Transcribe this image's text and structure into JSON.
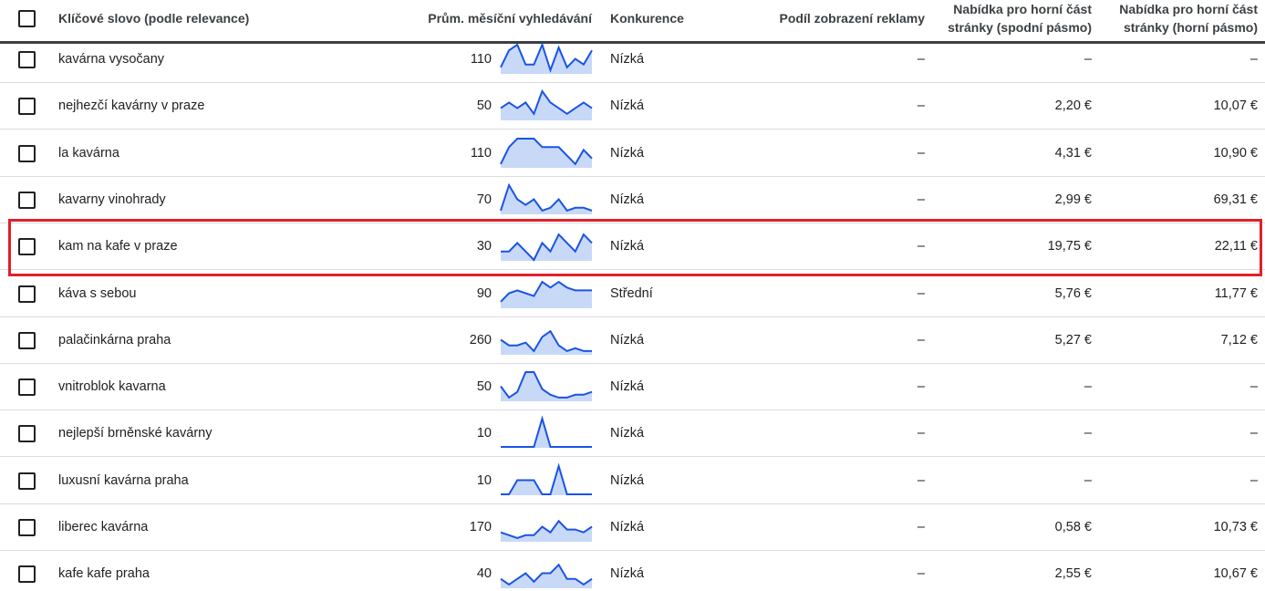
{
  "colors": {
    "spark_line": "#1a53e6",
    "spark_fill": "#c8d9f8",
    "highlight": "#e0202a"
  },
  "header": {
    "keyword": "Klíčové slovo (podle relevance)",
    "avg_searches": "Prům. měsíční vyhledávání",
    "competition": "Konkurence",
    "ad_impression_share": "Podíl zobrazení reklamy",
    "bid_low_line1": "Nabídka pro horní část",
    "bid_low_line2": "stránky (spodní pásmo)",
    "bid_high_line1": "Nabídka pro horní část",
    "bid_high_line2": "stránky (horní pásmo)"
  },
  "rows": [
    {
      "keyword": "kavárna vysočany",
      "searches": "110",
      "competition": "Nízká",
      "share": "–",
      "bid_low": "–",
      "bid_high": "–",
      "trend": [
        2,
        8,
        10,
        3,
        3,
        10,
        1,
        9,
        2,
        5,
        3,
        8
      ]
    },
    {
      "keyword": "nejhezčí kavárny v praze",
      "searches": "50",
      "competition": "Nízká",
      "share": "–",
      "bid_low": "2,20 €",
      "bid_high": "10,07 €",
      "trend": [
        4,
        6,
        4,
        6,
        2,
        10,
        6,
        4,
        2,
        4,
        6,
        4
      ]
    },
    {
      "keyword": "la kavárna",
      "searches": "110",
      "competition": "Nízká",
      "share": "–",
      "bid_low": "4,31 €",
      "bid_high": "10,90 €",
      "trend": [
        1,
        7,
        10,
        10,
        10,
        7,
        7,
        7,
        4,
        1,
        6,
        3
      ]
    },
    {
      "keyword": "kavarny vinohrady",
      "searches": "70",
      "competition": "Nízká",
      "share": "–",
      "bid_low": "2,99 €",
      "bid_high": "69,31 €",
      "trend": [
        1,
        10,
        5,
        3,
        5,
        1,
        2,
        5,
        1,
        2,
        2,
        1
      ]
    },
    {
      "keyword": "kam na kafe v praze",
      "searches": "30",
      "competition": "Nízká",
      "share": "–",
      "bid_low": "19,75 €",
      "bid_high": "22,11 €",
      "trend": [
        3,
        3,
        6,
        3,
        0,
        6,
        3,
        9,
        6,
        3,
        9,
        6
      ]
    },
    {
      "keyword": "káva s sebou",
      "searches": "90",
      "competition": "Střední",
      "share": "–",
      "bid_low": "5,76 €",
      "bid_high": "11,77 €",
      "trend": [
        2,
        5,
        6,
        5,
        4,
        9,
        7,
        9,
        7,
        6,
        6,
        6
      ]
    },
    {
      "keyword": "palačinkárna praha",
      "searches": "260",
      "competition": "Nízká",
      "share": "–",
      "bid_low": "5,27 €",
      "bid_high": "7,12 €",
      "trend": [
        5,
        3,
        3,
        4,
        1,
        6,
        8,
        3,
        1,
        2,
        1,
        1
      ]
    },
    {
      "keyword": "vnitroblok kavarna",
      "searches": "50",
      "competition": "Nízká",
      "share": "–",
      "bid_low": "–",
      "bid_high": "–",
      "trend": [
        5,
        1,
        3,
        10,
        10,
        4,
        2,
        1,
        1,
        2,
        2,
        3
      ]
    },
    {
      "keyword": "nejlepší brněnské kavárny",
      "searches": "10",
      "competition": "Nízká",
      "share": "–",
      "bid_low": "–",
      "bid_high": "–",
      "trend": [
        0,
        0,
        0,
        0,
        0,
        10,
        0,
        0,
        0,
        0,
        0,
        0
      ]
    },
    {
      "keyword": "luxusní kavárna praha",
      "searches": "10",
      "competition": "Nízká",
      "share": "–",
      "bid_low": "–",
      "bid_high": "–",
      "trend": [
        0,
        0,
        5,
        5,
        5,
        0,
        0,
        10,
        0,
        0,
        0,
        0
      ]
    },
    {
      "keyword": "liberec kavárna",
      "searches": "170",
      "competition": "Nízká",
      "share": "–",
      "bid_low": "0,58 €",
      "bid_high": "10,73 €",
      "trend": [
        3,
        2,
        1,
        2,
        2,
        5,
        3,
        7,
        4,
        4,
        3,
        5
      ]
    },
    {
      "keyword": "kafe kafe praha",
      "searches": "40",
      "competition": "Nízká",
      "share": "–",
      "bid_low": "2,55 €",
      "bid_high": "10,67 €",
      "trend": [
        3,
        1,
        3,
        5,
        2,
        5,
        5,
        8,
        3,
        3,
        1,
        3
      ]
    }
  ]
}
